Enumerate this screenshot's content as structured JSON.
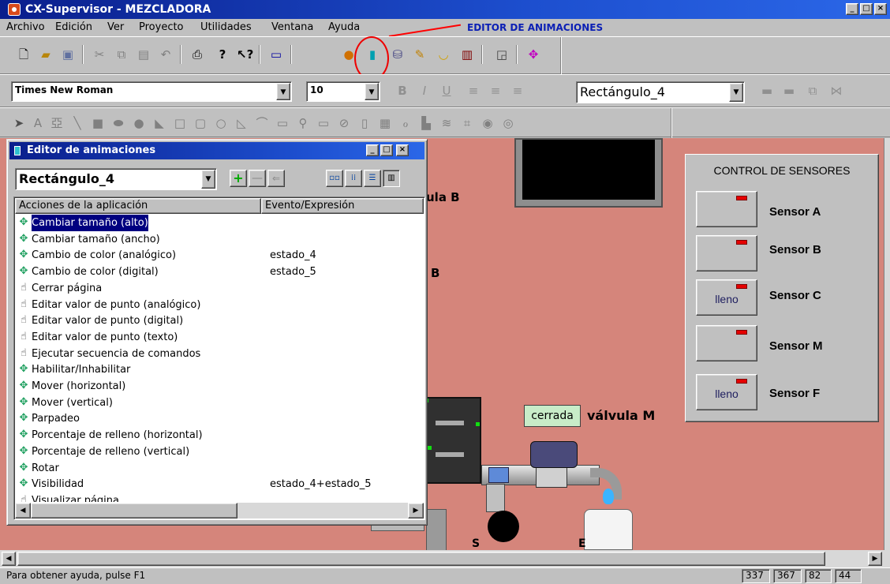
{
  "window": {
    "title": "CX-Supervisor - MEZCLADORA",
    "controls": [
      "_",
      "□",
      "×"
    ]
  },
  "menu": [
    "Archivo",
    "Edición",
    "Ver",
    "Proyecto",
    "Utilidades",
    "Ventana",
    "Ayuda"
  ],
  "annotation": {
    "label": "EDITOR DE ANIMACIONES",
    "color": "#0b1fb5",
    "highlight_color": "#e00000"
  },
  "toolbar1": {
    "icons": [
      "new-icon",
      "open-icon",
      "save-icon",
      "cut-icon",
      "copy-icon",
      "paste-icon",
      "undo-icon",
      "print-icon",
      "help-icon",
      "context-help-icon",
      "window-icon",
      "medal-icon",
      "animation-editor-icon",
      "objects-icon",
      "palette-icon",
      "bowls-icon",
      "library-icon",
      "properties-icon",
      "color-wheel-icon"
    ]
  },
  "format_bar": {
    "font": "Times New Roman",
    "size": "10",
    "object": "Rectángulo_4",
    "buttons": [
      "B",
      "I",
      "U"
    ]
  },
  "anim_editor": {
    "title": "Editor de animaciones",
    "object": "Rectángulo_4",
    "columns": [
      "Acciones de la aplicación",
      "Evento/Expresión"
    ],
    "rows": [
      {
        "label": "Cambiar tamaño (alto)",
        "event": "",
        "icon": "arrows-icon",
        "selected": true
      },
      {
        "label": "Cambiar tamaño (ancho)",
        "event": "",
        "icon": "arrows-icon"
      },
      {
        "label": "Cambio de color (analógico)",
        "event": "estado_4",
        "icon": "arrows-icon"
      },
      {
        "label": "Cambio de color (digital)",
        "event": "estado_5",
        "icon": "arrows-icon"
      },
      {
        "label": "Cerrar página",
        "event": "",
        "icon": "hand-icon"
      },
      {
        "label": "Editar valor de punto (analógico)",
        "event": "",
        "icon": "hand-icon"
      },
      {
        "label": "Editar valor de punto (digital)",
        "event": "",
        "icon": "hand-icon"
      },
      {
        "label": "Editar valor de punto (texto)",
        "event": "",
        "icon": "hand-icon"
      },
      {
        "label": "Ejecutar secuencia de comandos",
        "event": "",
        "icon": "hand-icon"
      },
      {
        "label": "Habilitar/Inhabilitar",
        "event": "",
        "icon": "arrows-icon"
      },
      {
        "label": "Mover (horizontal)",
        "event": "",
        "icon": "arrows-icon"
      },
      {
        "label": "Mover (vertical)",
        "event": "",
        "icon": "arrows-icon"
      },
      {
        "label": "Parpadeo",
        "event": "",
        "icon": "arrows-icon"
      },
      {
        "label": "Porcentaje de relleno (horizontal)",
        "event": "",
        "icon": "arrows-icon"
      },
      {
        "label": "Porcentaje de relleno (vertical)",
        "event": "",
        "icon": "arrows-icon"
      },
      {
        "label": "Rotar",
        "event": "",
        "icon": "arrows-icon"
      },
      {
        "label": "Visibilidad",
        "event": "estado_4+estado_5",
        "icon": "arrows-icon"
      },
      {
        "label": "Visualizar página",
        "event": "",
        "icon": "hand-icon"
      }
    ]
  },
  "canvas": {
    "bg_color": "#d5857b",
    "labels": {
      "valve_b": "ula B",
      "b_text": "B",
      "valve_m": "válvula M",
      "valve_m_state": "cerrada",
      "sensor_e": "S E"
    }
  },
  "sensor_panel": {
    "title": "CONTROL DE SENSORES",
    "sensors": [
      {
        "name": "Sensor A",
        "state": ""
      },
      {
        "name": "Sensor B",
        "state": ""
      },
      {
        "name": "Sensor C",
        "state": "lleno"
      },
      {
        "name": "Sensor M",
        "state": ""
      },
      {
        "name": "Sensor F",
        "state": "lleno"
      }
    ]
  },
  "status": {
    "help": "Para obtener ayuda, pulse F1",
    "values": [
      "337",
      "367",
      "82",
      "44"
    ]
  }
}
